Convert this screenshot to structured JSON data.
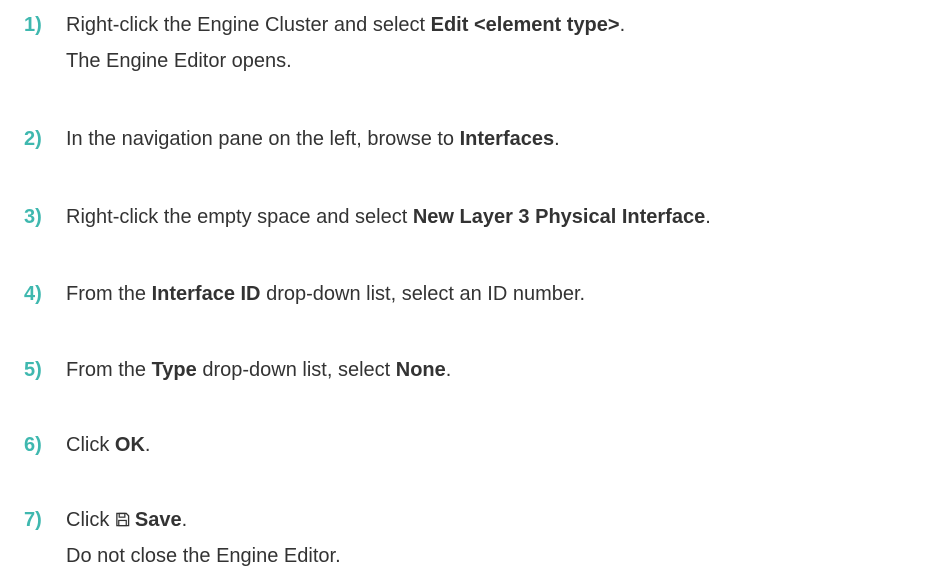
{
  "steps": [
    {
      "number": "1)",
      "pre": "Right-click the Engine Cluster and select ",
      "bold": "Edit <element type>",
      "post": ".",
      "result": "The Engine Editor opens."
    },
    {
      "number": "2)",
      "pre": "In the navigation pane on the left, browse to ",
      "bold": "Interfaces",
      "post": "."
    },
    {
      "number": "3)",
      "pre": "Right-click the empty space and select ",
      "bold": "New Layer 3 Physical Interface",
      "post": "."
    },
    {
      "number": "4)",
      "pre": "From the ",
      "bold": "Interface ID",
      "post": " drop-down list, select an ID number."
    },
    {
      "number": "5)",
      "pre": "From the ",
      "bold": "Type",
      "mid": " drop-down list, select ",
      "bold2": "None",
      "post": "."
    },
    {
      "number": "6)",
      "pre": "Click ",
      "bold": "OK",
      "post": "."
    },
    {
      "number": "7)",
      "pre": "Click ",
      "icon": "save-icon",
      "bold": "Save",
      "post": ".",
      "result": "Do not close the Engine Editor."
    }
  ],
  "colors": {
    "step_number": "#3fb8af",
    "text": "#333333"
  }
}
